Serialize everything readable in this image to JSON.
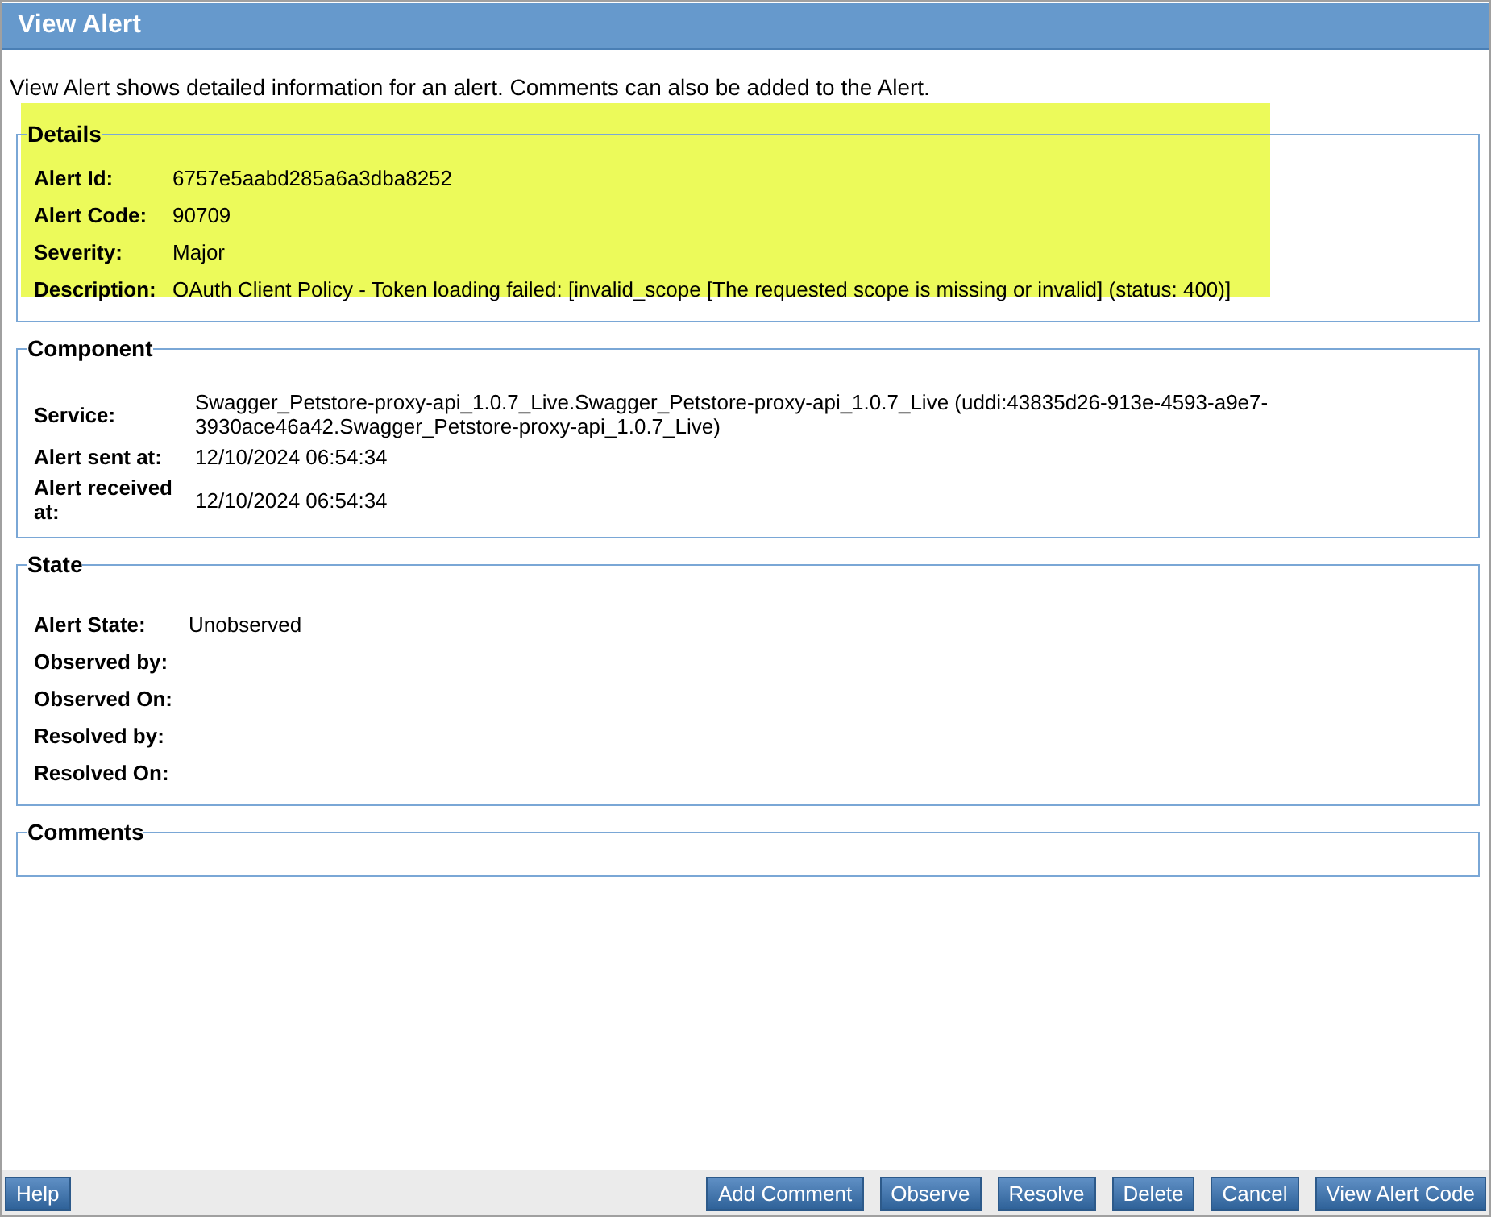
{
  "window": {
    "title": "View Alert"
  },
  "intro": "View Alert shows detailed information for an alert. Comments can also be added to the Alert.",
  "sections": [
    {
      "title": "Details",
      "highlighted": true,
      "rows": [
        {
          "label": "Alert Id:",
          "value": "6757e5aabd285a6a3dba8252"
        },
        {
          "label": "Alert Code:",
          "value": "90709"
        },
        {
          "label": "Severity:",
          "value": "Major"
        },
        {
          "label": "Description:",
          "value": "OAuth Client Policy - Token loading failed: [invalid_scope [The requested scope is missing or invalid] (status: 400)]"
        }
      ]
    },
    {
      "title": "Component",
      "highlighted": false,
      "rows": [
        {
          "label": "Service:",
          "value": "Swagger_Petstore-proxy-api_1.0.7_Live.Swagger_Petstore-proxy-api_1.0.7_Live (uddi:43835d26-913e-4593-a9e7-3930ace46a42.Swagger_Petstore-proxy-api_1.0.7_Live)"
        },
        {
          "label": "Alert sent at:",
          "value": "12/10/2024 06:54:34"
        },
        {
          "label": "Alert received at:",
          "value": "12/10/2024 06:54:34"
        }
      ]
    },
    {
      "title": "State",
      "highlighted": false,
      "rows": [
        {
          "label": "Alert State:",
          "value": "Unobserved"
        },
        {
          "label": "Observed by:"
        },
        {
          "label": "Observed On:"
        },
        {
          "label": "Resolved by:"
        },
        {
          "label": "Resolved On:"
        }
      ]
    },
    {
      "title": "Comments",
      "highlighted": false
    }
  ],
  "footer": {
    "left_buttons": [
      "Help"
    ],
    "right_buttons": [
      "Add Comment",
      "Observe",
      "Resolve",
      "Delete",
      "Cancel",
      "View Alert Code"
    ]
  }
}
